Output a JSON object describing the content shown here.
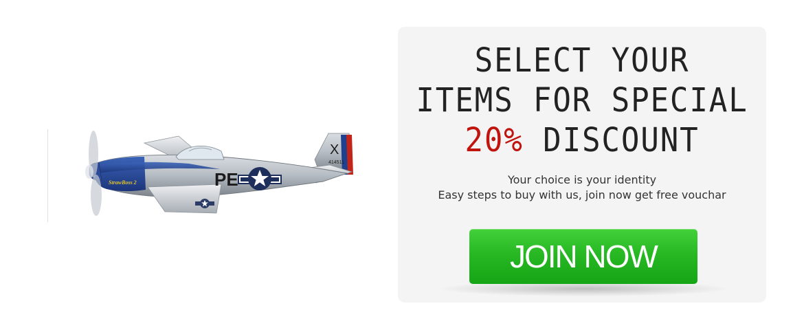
{
  "hero": {
    "image_icon": "p51-mustang-airplane-icon",
    "aircraft_markings": {
      "code": "PE",
      "tail_letter": "X",
      "tail_number": "414511",
      "nose_art": "StrawBoss 2"
    }
  },
  "promo": {
    "headline": {
      "line1": "SELECT YOUR",
      "line2": "ITEMS FOR SPECIAL",
      "discount": "20%",
      "line3_rest": " DISCOUNT"
    },
    "subtext": {
      "line1": "Your choice is your identity",
      "line2": "Easy steps to buy with us, join now get free vouchar"
    },
    "cta_label": "JOIN NOW"
  },
  "colors": {
    "accent_red": "#c0140f",
    "button_green": "#27b823",
    "card_bg": "#f4f4f4",
    "text_dark": "#222222"
  }
}
